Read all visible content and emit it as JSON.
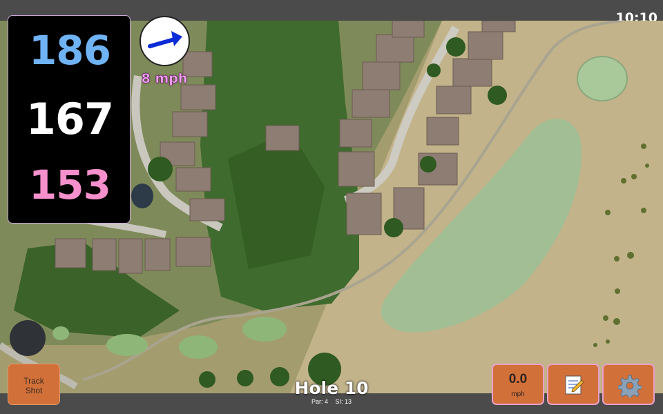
{
  "status": {
    "time": "10:10"
  },
  "distances": {
    "back": {
      "value": "186",
      "color": "#6fb3f5"
    },
    "middle": {
      "value": "167",
      "color": "#ffffff"
    },
    "front": {
      "value": "153",
      "color": "#f590cc"
    }
  },
  "wind": {
    "speed_label": "8 mph",
    "direction_icon": "arrow-right-up-icon"
  },
  "hole": {
    "title": "Hole 10",
    "par": "Par: 4",
    "stroke_index": "SI: 13"
  },
  "buttons": {
    "track_shot": {
      "line1": "Track",
      "line2": "Shot"
    },
    "speed": {
      "value": "0.0",
      "unit": "mph"
    },
    "notes_icon": "notepad-icon",
    "settings_icon": "gear-icon"
  },
  "colors": {
    "button_bg": "#d2703a",
    "panel_bg": "#000000",
    "bar_bg": "#4b4b4b"
  }
}
